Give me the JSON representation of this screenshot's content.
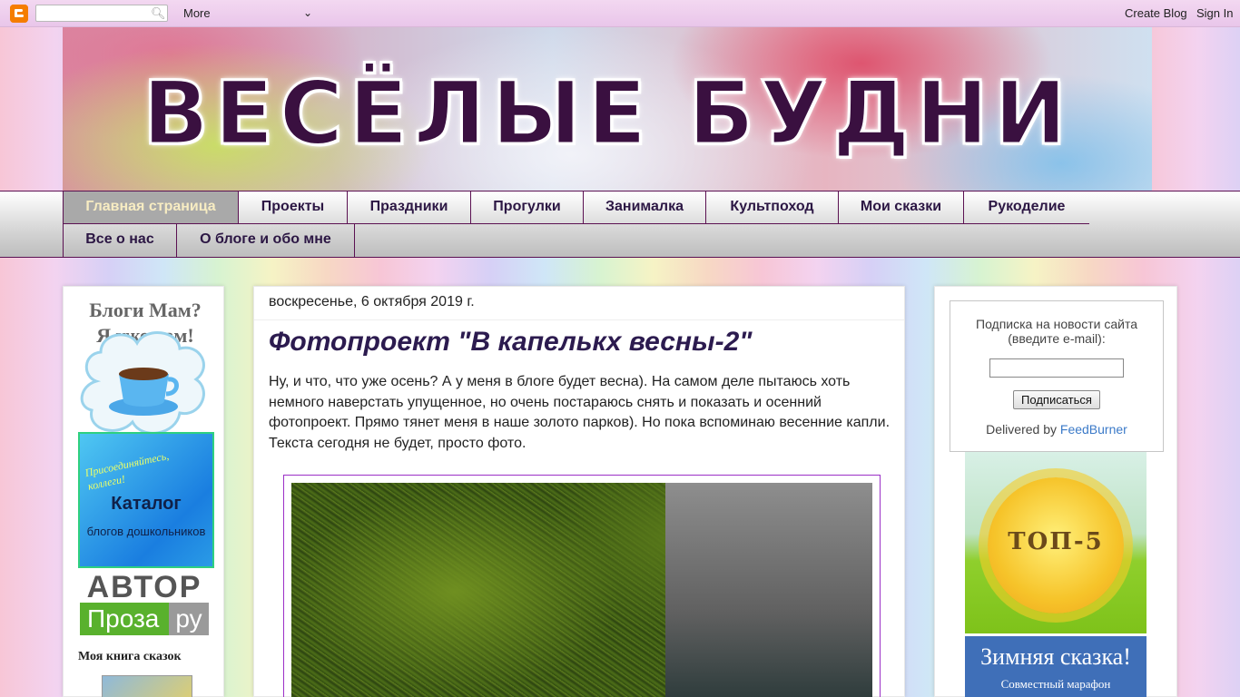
{
  "navbar": {
    "search_placeholder": "",
    "more_label": "More",
    "create_blog": "Create Blog",
    "sign_in": "Sign In"
  },
  "header": {
    "title": "ВЕСЁЛЫЕ БУДНИ"
  },
  "tabs": {
    "row1": [
      "Главная страница",
      "Проекты",
      "Праздники",
      "Прогулки",
      "Занималка",
      "Культпоход",
      "Мои сказки",
      "Рукоделие"
    ],
    "row2": [
      "Все о нас",
      "О блоге и обо мне"
    ],
    "active": "Главная страница"
  },
  "sidebar_left": {
    "mom_badge_line1": "Блоги Мам?",
    "mom_badge_line2": "Я уже там!",
    "catalog_join": "Присоединяйтесь, коллеги!",
    "catalog_title": "Каталог",
    "catalog_sub": "блогов дошкольников",
    "avtor_top": "АВТОР",
    "avtor_proza": "Проза",
    "avtor_ru": "ру",
    "book_title": "Моя книга сказок"
  },
  "post": {
    "date": "воскресенье, 6 октября 2019 г.",
    "title": "Фотопроект \"В капелькх весны-2\"",
    "body": "Ну, и что, что уже осень? А у меня в блоге будет весна). На самом деле пытаюсь хоть немного наверстать упущенное, но очень постараюсь снять и показать и осенний фотопроект. Прямо тянет меня в наше золото парков). Но пока вспоминаю весенние капли. Текста сегодня не будет, просто фото."
  },
  "sidebar_right": {
    "subscribe_label": "Подписка на новости сайта (введите e-mail):",
    "subscribe_button": "Подписаться",
    "delivered_by": "Delivered by",
    "feedburner": "FeedBurner",
    "top5_text": "ТОП-5",
    "winter_title": "Зимняя сказка!",
    "winter_sub": "Совместный марафон"
  },
  "colors": {
    "accent_purple": "#5b1152",
    "title_color": "#2c1b4f",
    "link_blue": "#3b7ac8",
    "active_tab_text": "#f7ecc2"
  }
}
